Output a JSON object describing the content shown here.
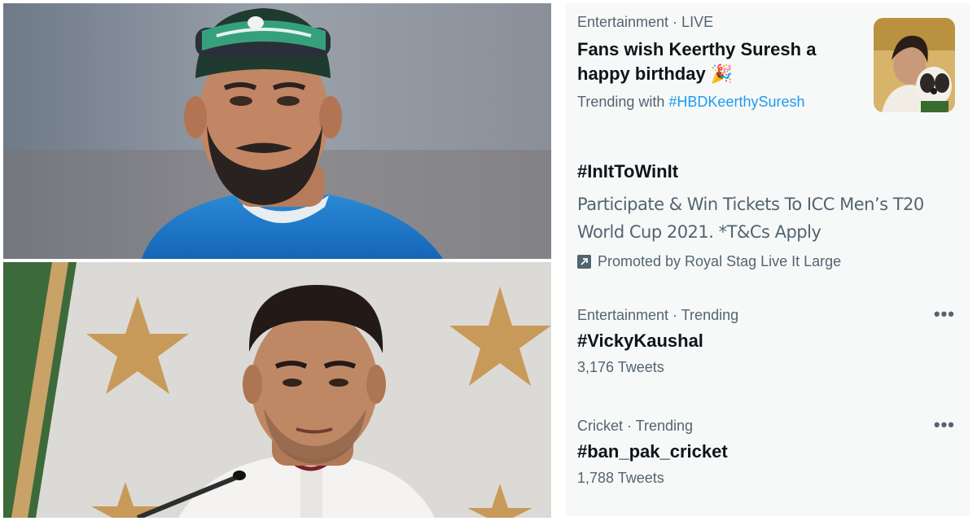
{
  "images": {
    "top_photo": {
      "alt": "photo-cricketer-cap"
    },
    "bottom_photo": {
      "alt": "photo-cricketer-press-conference"
    }
  },
  "trends": [
    {
      "meta": "Entertainment · LIVE",
      "headline": "Fans wish Keerthy Suresh a happy birthday 🎉",
      "trending_with_label": "Trending with",
      "trending_with_hashtag": "#HBDKeerthySuresh"
    },
    {
      "headline": "#InItToWinIt",
      "description": "Participate & Win Tickets To ICC Men’s T20 World Cup 2021. *T&Cs Apply",
      "promoted": "Promoted by Royal Stag Live It Large"
    },
    {
      "meta": "Entertainment · Trending",
      "headline": "#VickyKaushal",
      "count": "3,176 Tweets"
    },
    {
      "meta": "Cricket · Trending",
      "headline": "#ban_pak_cricket",
      "count": "1,788 Tweets"
    }
  ],
  "icons": {
    "more": "more-horizontal-icon",
    "promoted": "promoted-arrow-icon"
  },
  "colors": {
    "link": "#1d9bf0",
    "muted": "#536471",
    "panel_bg": "#f7f9f9",
    "text": "#0f1419"
  }
}
